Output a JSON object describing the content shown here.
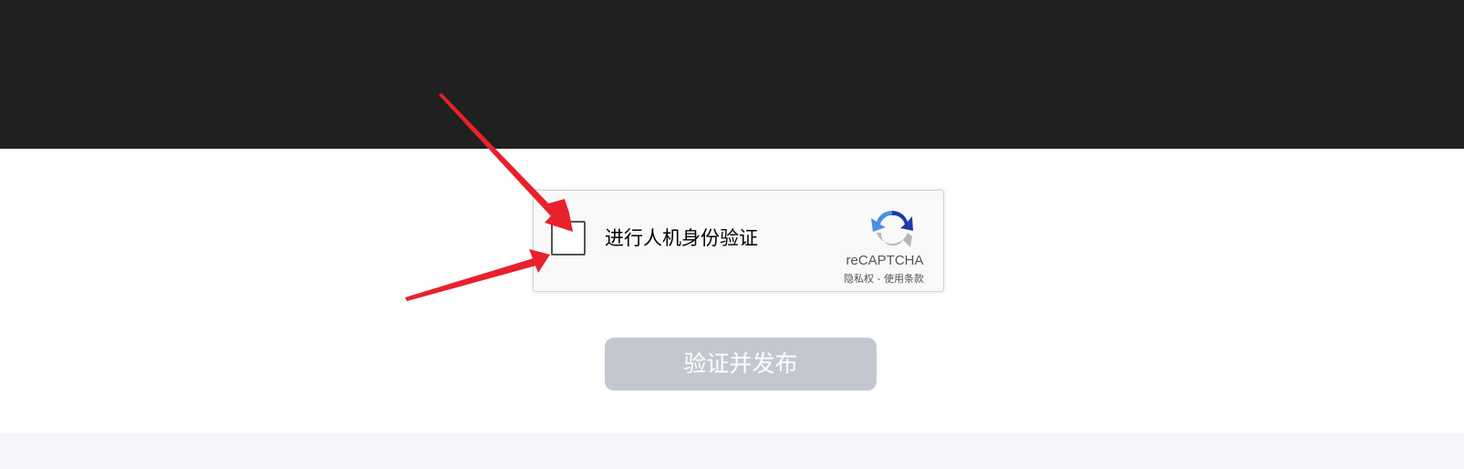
{
  "recaptcha": {
    "label": "进行人机身份验证",
    "brand": "reCAPTCHA",
    "privacy_link": "隐私权",
    "separator": " - ",
    "terms_link": "使用条款",
    "logo_icon": "recaptcha-logo-icon",
    "checked": false
  },
  "submit": {
    "label": "验证并发布",
    "enabled": false
  },
  "annotations": {
    "arrow_color": "#e8212b",
    "arrow_count": 2
  },
  "colors": {
    "top_bar": "#202020",
    "button_disabled": "#c3c8d0",
    "footer_strip": "#f4f5f9"
  }
}
